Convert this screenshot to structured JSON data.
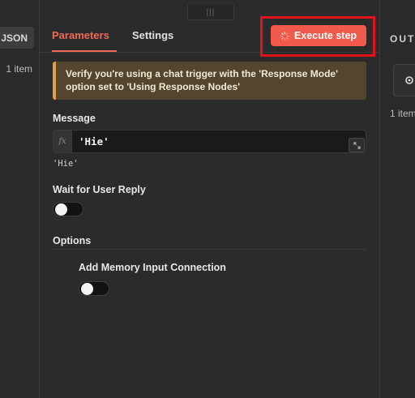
{
  "input_panel": {
    "mode_button": "JSON",
    "item_count": "1 item"
  },
  "tabs": [
    {
      "label": "Parameters",
      "active": true
    },
    {
      "label": "Settings",
      "active": false
    }
  ],
  "execute_button": {
    "label": "Execute step",
    "icon": "spinner-icon",
    "color": "#f05a4a"
  },
  "highlight_color": "#e0131b",
  "warning": {
    "line1": "Verify you're using a chat trigger with the 'Response Mode'",
    "line2": "option set to 'Using Response Nodes'"
  },
  "fields": {
    "message": {
      "label": "Message",
      "fx_icon": "fx",
      "value": "'Hie'",
      "preview": "'Hie'"
    },
    "wait_for_reply": {
      "label": "Wait for User Reply",
      "enabled": false
    },
    "options": {
      "label": "Options"
    },
    "memory_connection": {
      "label": "Add Memory Input Connection",
      "enabled": false
    }
  },
  "output_panel": {
    "title": "OUTPUT",
    "item_count": "1 item",
    "icon": "gear-icon"
  }
}
